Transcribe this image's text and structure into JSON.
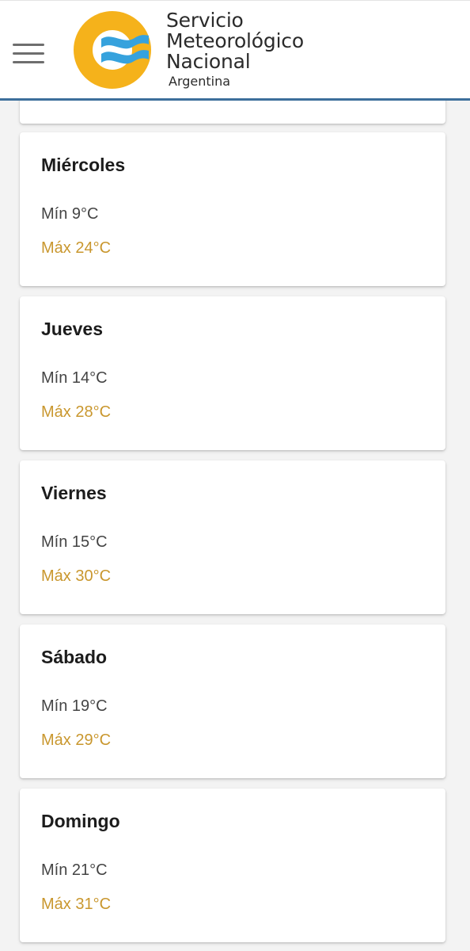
{
  "header": {
    "menu_icon": "hamburger-menu-icon",
    "logo": {
      "icon": "smn-logo-icon",
      "line1": "Servicio",
      "line2": "Meteorológico",
      "line3": "Nacional",
      "country": "Argentina"
    }
  },
  "colors": {
    "header_rule": "#3d6f9b",
    "logo_yellow": "#f5b21b",
    "logo_blue": "#36a2dd",
    "max_temp": "#c9972e",
    "min_temp": "#444444"
  },
  "forecast": [
    {
      "day": "Miércoles",
      "min": "Mín 9°C",
      "max": "Máx 24°C"
    },
    {
      "day": "Jueves",
      "min": "Mín 14°C",
      "max": "Máx 28°C"
    },
    {
      "day": "Viernes",
      "min": "Mín 15°C",
      "max": "Máx 30°C"
    },
    {
      "day": "Sábado",
      "min": "Mín 19°C",
      "max": "Máx 29°C"
    },
    {
      "day": "Domingo",
      "min": "Mín 21°C",
      "max": "Máx 31°C"
    }
  ]
}
